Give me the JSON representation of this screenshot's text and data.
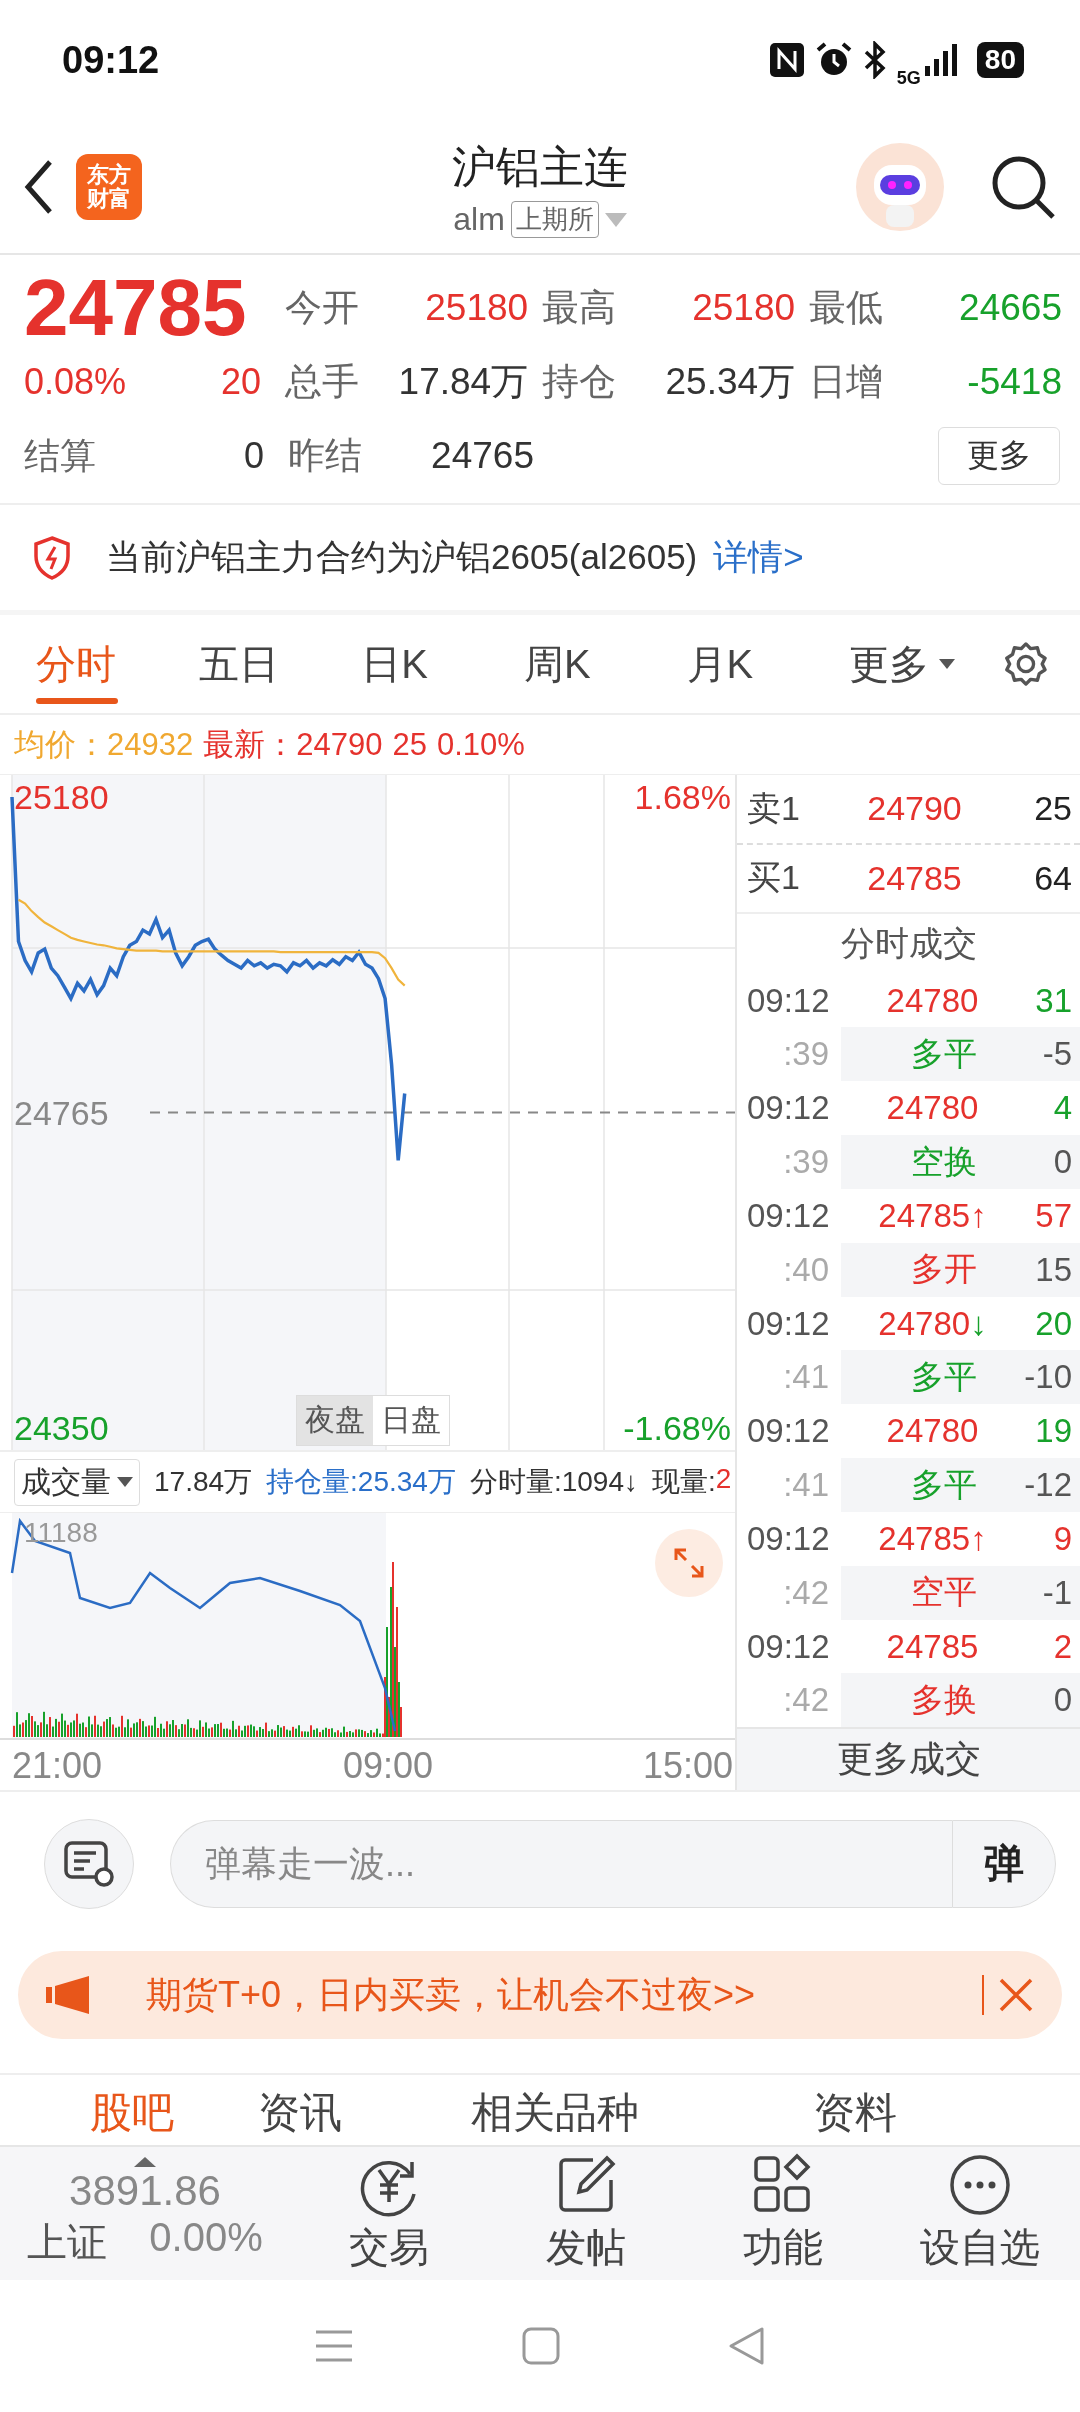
{
  "status_bar": {
    "time": "09:12",
    "network": "5G",
    "battery": "80"
  },
  "header": {
    "logo": [
      "东方",
      "财富"
    ],
    "title": "沪铝主连",
    "code": "alm",
    "exchange": "上期所"
  },
  "quote": {
    "price": "24785",
    "change_pct": "0.08%",
    "change": "20",
    "settle_label": "结算",
    "settle_value": "0",
    "more": "更多",
    "stats": [
      {
        "label": "今开",
        "value": "25180",
        "color": "#e5322d"
      },
      {
        "label": "最高",
        "value": "25180",
        "color": "#e5322d"
      },
      {
        "label": "最低",
        "value": "24665",
        "color": "#17a12b"
      },
      {
        "label": "总手",
        "value": "17.84万",
        "color": "#333333"
      },
      {
        "label": "持仓",
        "value": "25.34万",
        "color": "#333333"
      },
      {
        "label": "日增",
        "value": "-5418",
        "color": "#17a12b"
      },
      {
        "label": "昨结",
        "value": "24765",
        "color": "#333333"
      }
    ]
  },
  "notice": {
    "text": "当前沪铝主力合约为沪铝2605(al2605)",
    "link": "详情>"
  },
  "chart_tabs": [
    {
      "label": "分时",
      "selected": true
    },
    {
      "label": "五日",
      "selected": false
    },
    {
      "label": "日K",
      "selected": false
    },
    {
      "label": "周K",
      "selected": false
    },
    {
      "label": "月K",
      "selected": false
    },
    {
      "label": "更多",
      "selected": false,
      "kind": "menu"
    }
  ],
  "info_line": {
    "avg_label": "均价：",
    "avg": "24932",
    "last_label": "最新：",
    "last": "24790",
    "last_volume": "25",
    "last_pct": "0.10%"
  },
  "chart": {
    "pct_labels": [
      {
        "text": "1.68%",
        "color": "#e5322d"
      },
      {
        "text": "-1.68%",
        "color": "#17a12b"
      }
    ],
    "session_buttons": [
      {
        "label": "夜盘",
        "selected": true
      },
      {
        "label": "日盘",
        "selected": false
      }
    ],
    "chart_data": {
      "type": "line",
      "categories": [
        null,
        null,
        null,
        null,
        null,
        null,
        null,
        null,
        null,
        null,
        null,
        null,
        null,
        null,
        null,
        null,
        null,
        null,
        null,
        null,
        null,
        null,
        null,
        null,
        null,
        null,
        null,
        null,
        null,
        null,
        null,
        null,
        null,
        null,
        null,
        null,
        null,
        null,
        null,
        null,
        null,
        null,
        null,
        null,
        null,
        null,
        null,
        null,
        null,
        null,
        null,
        null,
        null,
        null,
        null,
        null,
        null,
        null,
        null,
        null,
        null,
        null,
        null,
        null,
        null,
        null,
        null,
        null,
        null,
        null,
        null,
        null,
        null,
        null,
        null,
        null,
        null,
        null,
        null,
        null,
        null,
        null,
        null,
        null,
        null,
        null,
        null,
        null,
        null,
        null,
        null,
        null,
        null,
        null,
        null,
        null,
        null,
        null,
        null,
        null,
        null,
        null,
        null,
        null,
        null,
        null,
        null,
        null,
        null,
        null,
        null
      ],
      "series": [
        {
          "color": "#2b6cc4",
          "values": [
            25180,
            24990,
            24965,
            24950,
            24975,
            24980,
            24955,
            24945,
            24930,
            24915,
            24935,
            24925,
            24940,
            24920,
            24932,
            24955,
            24945,
            24970,
            24985,
            24990,
            25005,
            25000,
            25019,
            24995,
            25005,
            24975,
            24958,
            24970,
            24985,
            24990,
            24993,
            24980,
            24972,
            24965,
            24960,
            24955,
            24965,
            24958,
            24962,
            24955,
            24960,
            24958,
            24950,
            24962,
            24958,
            24965,
            24955,
            24962,
            24958,
            24966,
            24960,
            24970,
            24965,
            24976,
            24960,
            24955,
            24941,
            24915,
            24828,
            24702,
            24790,
            null,
            null,
            null,
            null,
            null,
            null,
            null,
            null,
            null,
            null,
            null,
            null,
            null,
            null,
            null,
            null,
            null,
            null,
            null,
            null,
            null,
            null,
            null,
            null,
            null,
            null,
            null,
            null,
            null,
            null,
            null,
            null,
            null,
            null,
            null,
            null,
            null,
            null,
            null,
            null,
            null,
            null,
            null,
            null,
            null,
            null,
            null,
            null,
            null,
            null
          ]
        },
        {
          "color": "#f0b43c",
          "values": [
            null,
            25045,
            25040,
            25030,
            25022,
            25015,
            25010,
            25005,
            25000,
            24995,
            24992,
            24990,
            24988,
            24986,
            24985,
            24983,
            24981,
            24980,
            24979,
            24978,
            24978,
            24978,
            24978,
            24977,
            24977,
            24977,
            24977,
            24977,
            24977,
            24977,
            24977,
            24977,
            24977,
            24977,
            24977,
            24977,
            24977,
            24977,
            24977,
            24977,
            24977,
            24976,
            24976,
            24976,
            24976,
            24976,
            24976,
            24976,
            24976,
            24976,
            24976,
            24976,
            24976,
            24976,
            24976,
            24976,
            24975,
            24968,
            24955,
            24940,
            24932,
            null,
            null,
            null,
            null,
            null,
            null,
            null,
            null,
            null,
            null,
            null,
            null,
            null,
            null,
            null,
            null,
            null,
            null,
            null,
            null,
            null,
            null,
            null,
            null,
            null,
            null,
            null,
            null,
            null,
            null,
            null,
            null,
            null,
            null,
            null,
            null,
            null,
            null,
            null,
            null,
            null,
            null,
            null,
            null,
            null,
            null,
            null,
            null,
            null,
            null
          ]
        }
      ],
      "ylim": [
        24321,
        25209
      ],
      "ref_lines": [
        {
          "axis": "y",
          "value": 24765,
          "color": "#888888"
        }
      ],
      "yticks": [
        {
          "value": 25180,
          "label": "25180"
        },
        {
          "value": 24765,
          "label": "24765"
        },
        {
          "value": 24350,
          "label": "24350"
        }
      ]
    }
  },
  "time_axis": [
    "21:00",
    "09:00",
    "15:00"
  ],
  "volume": {
    "dropdown": "成交量",
    "total": "17.84万",
    "open_interest": "持仓量:25.34万",
    "tick_volume": "分时量:1094↓",
    "current_label": "现量:",
    "current_value": "2",
    "max_label": "11188"
  },
  "order_book": [
    {
      "label": "卖1",
      "price": "24790",
      "volume": "25"
    },
    {
      "label": "买1",
      "price": "24785",
      "volume": "64"
    }
  ],
  "trades_title": "分时成交",
  "trades": [
    {
      "time": "09:12",
      "sec": ":39",
      "price": "24780",
      "volume": "31",
      "color": "#17a12b",
      "action": "多平",
      "change": "-5"
    },
    {
      "time": "09:12",
      "sec": ":39",
      "price": "24780",
      "volume": "4",
      "color": "#17a12b",
      "action": "空换",
      "change": "0"
    },
    {
      "time": "09:12",
      "sec": ":40",
      "price": "24785",
      "arrow": "↑",
      "volume": "57",
      "color": "#e5322d",
      "action": "多开",
      "change": "15"
    },
    {
      "time": "09:12",
      "sec": ":41",
      "price": "24780",
      "arrow": "↓",
      "volume": "20",
      "color": "#17a12b",
      "action": "多平",
      "change": "-10"
    },
    {
      "time": "09:12",
      "sec": ":41",
      "price": "24780",
      "volume": "19",
      "color": "#17a12b",
      "action": "多平",
      "change": "-12"
    },
    {
      "time": "09:12",
      "sec": ":42",
      "price": "24785",
      "arrow": "↑",
      "volume": "9",
      "color": "#e5322d",
      "action": "空平",
      "change": "-1"
    },
    {
      "time": "09:12",
      "sec": ":42",
      "price": "24785",
      "volume": "2",
      "color": "#e5322d",
      "action": "多换",
      "change": "0"
    }
  ],
  "trades_more": "更多成交",
  "comment": {
    "placeholder": "弹幕走一波...",
    "send": "弹"
  },
  "promo": {
    "text": "期货T+0，日内买卖，让机会不过夜>>"
  },
  "section_tabs": [
    {
      "label": "股吧",
      "selected": true
    },
    {
      "label": "资讯",
      "selected": false
    },
    {
      "label": "相关品种",
      "selected": false
    },
    {
      "label": "资料",
      "selected": false
    }
  ],
  "bottom_nav": {
    "index_value": "3891.86",
    "index_name": "上证",
    "index_change": "0.00%",
    "items": [
      {
        "label": "交易",
        "kind": "trade"
      },
      {
        "label": "发帖",
        "kind": "post"
      },
      {
        "label": "功能",
        "kind": "apps"
      },
      {
        "label": "设自选",
        "kind": "more"
      }
    ]
  }
}
